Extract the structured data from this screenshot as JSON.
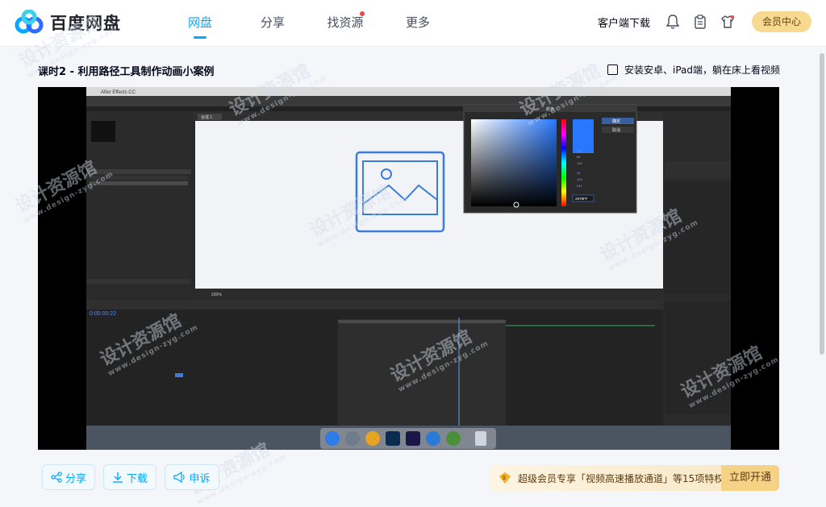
{
  "header": {
    "logo_text": "百度网盘",
    "nav": [
      {
        "label": "网盘",
        "active": true
      },
      {
        "label": "分享",
        "active": false
      },
      {
        "label": "找资源",
        "active": false,
        "dot": true
      },
      {
        "label": "更多",
        "active": false
      }
    ],
    "client_download": "客户端下载",
    "vip_center": "会员中心",
    "icons": [
      "bell-icon",
      "clipboard-icon",
      "shirt-icon"
    ]
  },
  "lesson": {
    "title": "课时2 - 利用路径工具制作动画小案例",
    "mobile_option": "安装安卓、iPad端，躺在床上看视频"
  },
  "video": {
    "app_title": "After Effects CC",
    "composition_tab": "合成 1",
    "timecode": "0:00:00:22",
    "color_picker_title": "颜色",
    "color_picker_ok": "确定",
    "color_picker_cancel": "取消",
    "color_hex": "2878FF",
    "zoom": "200%",
    "hue": "217",
    "sat": "84",
    "bri": "100",
    "r": "41",
    "g": "123",
    "b": "241",
    "accent": "#2a6fdb"
  },
  "actions": {
    "share": "分享",
    "download": "下载",
    "report": "申诉"
  },
  "promo": {
    "text": "超级会员专享「视频高速播放通道」等15项特权",
    "open": "立即开通"
  },
  "watermark": {
    "text": "设计资源馆",
    "url": "www.design-zyg.com"
  }
}
